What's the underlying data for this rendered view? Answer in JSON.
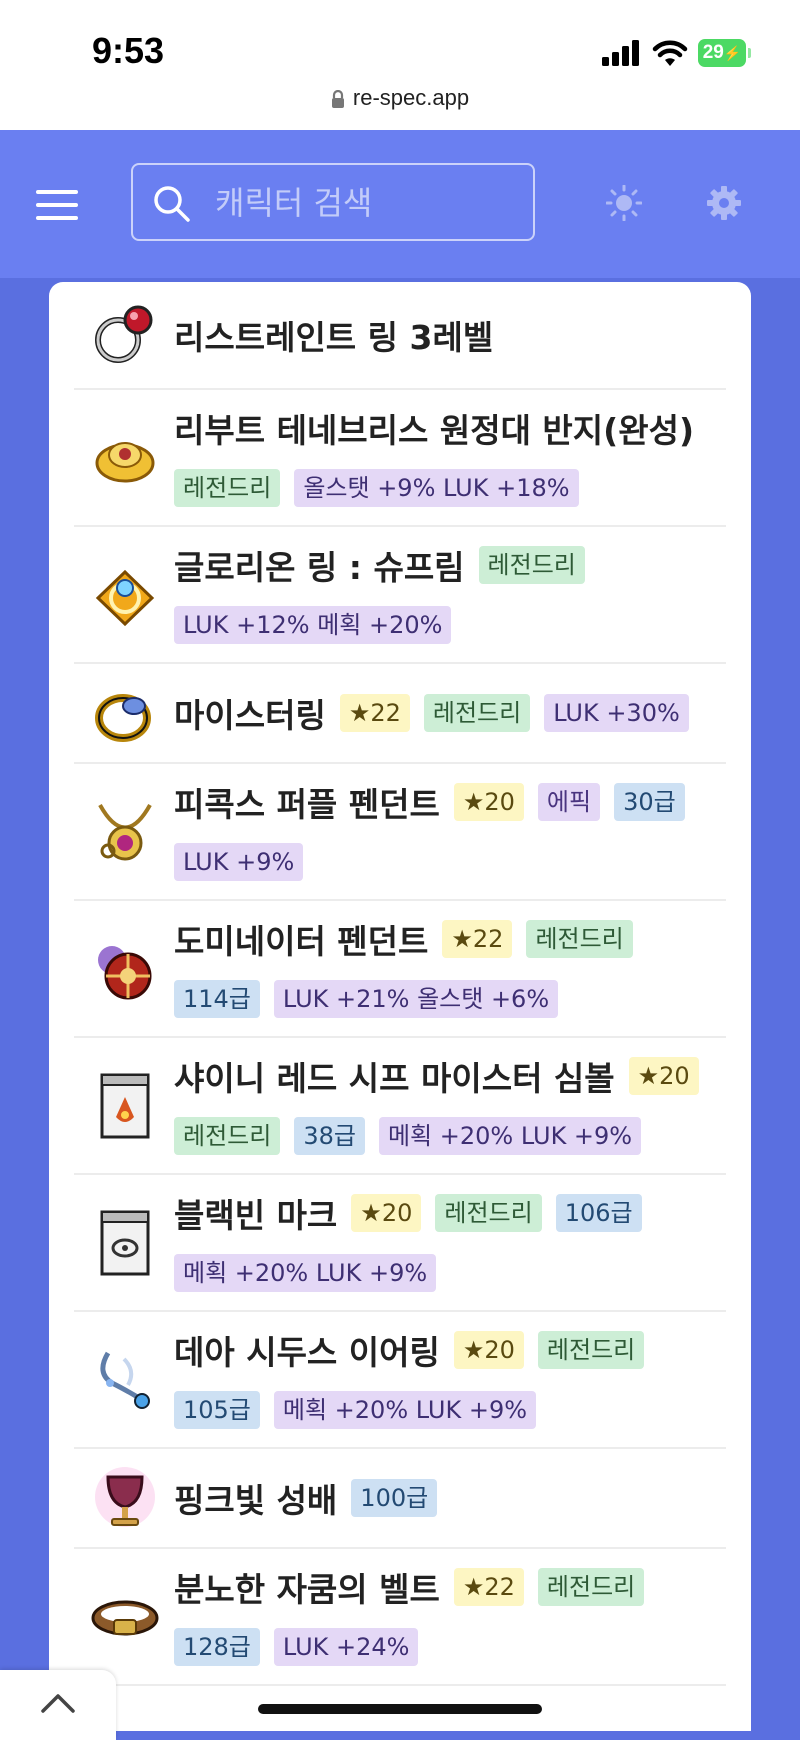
{
  "status_bar": {
    "time": "9:53",
    "battery": "29",
    "url": "re-spec.app"
  },
  "header": {
    "search_placeholder": "캐릭터 검색",
    "icons": [
      "hamburger-menu-icon",
      "search-icon",
      "sun-icon",
      "gear-icon"
    ]
  },
  "items": [
    {
      "name": "리스트레인트 링 3레벨",
      "icon": "restraint-ring-icon",
      "rows": [
        []
      ]
    },
    {
      "name": "리부트 테네브리스 원정대 반지(완성)",
      "icon": "tenebris-ring-icon",
      "rows": [
        [],
        [
          {
            "type": "leg",
            "text": "레전드리"
          },
          {
            "type": "stat",
            "text": "올스탯 +9% LUK +18%"
          }
        ]
      ]
    },
    {
      "name": "글로리온 링 : 슈프림",
      "icon": "glorion-ring-icon",
      "rows": [
        [
          {
            "type": "leg",
            "text": "레전드리"
          }
        ],
        [
          {
            "type": "stat",
            "text": "LUK +12% 메획 +20%"
          }
        ]
      ]
    },
    {
      "name": "마이스터링",
      "icon": "meister-ring-icon",
      "rows": [
        [
          {
            "type": "star",
            "text": "22"
          },
          {
            "type": "leg",
            "text": "레전드리"
          },
          {
            "type": "stat",
            "text": "LUK +30%"
          }
        ]
      ]
    },
    {
      "name": "피콕스 퍼플 펜던트",
      "icon": "peacock-pendant-icon",
      "rows": [
        [
          {
            "type": "star",
            "text": "20"
          },
          {
            "type": "epic",
            "text": "에픽"
          },
          {
            "type": "grade",
            "text": "30급"
          }
        ],
        [
          {
            "type": "stat",
            "text": "LUK +9%"
          }
        ]
      ]
    },
    {
      "name": "도미네이터 펜던트",
      "icon": "dominator-pendant-icon",
      "rows": [
        [
          {
            "type": "star",
            "text": "22"
          },
          {
            "type": "leg",
            "text": "레전드리"
          }
        ],
        [
          {
            "type": "grade",
            "text": "114급"
          },
          {
            "type": "stat",
            "text": "LUK +21% 올스탯 +6%"
          }
        ]
      ]
    },
    {
      "name": "샤이니 레드 시프 마이스터 심볼",
      "icon": "meister-symbol-icon",
      "rows": [
        [
          {
            "type": "star",
            "text": "20"
          }
        ],
        [
          {
            "type": "leg",
            "text": "레전드리"
          },
          {
            "type": "grade",
            "text": "38급"
          },
          {
            "type": "stat",
            "text": "메획 +20% LUK +9%"
          }
        ]
      ]
    },
    {
      "name": "블랙빈 마크",
      "icon": "blackbean-mark-icon",
      "rows": [
        [
          {
            "type": "star",
            "text": "20"
          },
          {
            "type": "leg",
            "text": "레전드리"
          },
          {
            "type": "grade",
            "text": "106급"
          }
        ],
        [
          {
            "type": "stat",
            "text": "메획 +20% LUK +9%"
          }
        ]
      ]
    },
    {
      "name": "데아 시두스 이어링",
      "icon": "dea-sidus-earring-icon",
      "rows": [
        [
          {
            "type": "star",
            "text": "20"
          },
          {
            "type": "leg",
            "text": "레전드리"
          }
        ],
        [
          {
            "type": "grade",
            "text": "105급"
          },
          {
            "type": "stat",
            "text": "메획 +20% LUK +9%"
          }
        ]
      ]
    },
    {
      "name": "핑크빛 성배",
      "icon": "pink-holy-cup-icon",
      "rows": [
        [
          {
            "type": "grade",
            "text": "100급"
          }
        ]
      ]
    },
    {
      "name": "분노한 자쿰의 벨트",
      "icon": "zakum-belt-icon",
      "rows": [
        [
          {
            "type": "star",
            "text": "22"
          },
          {
            "type": "leg",
            "text": "레전드리"
          }
        ],
        [
          {
            "type": "grade",
            "text": "128급"
          },
          {
            "type": "stat",
            "text": "LUK +24%"
          }
        ]
      ]
    }
  ]
}
